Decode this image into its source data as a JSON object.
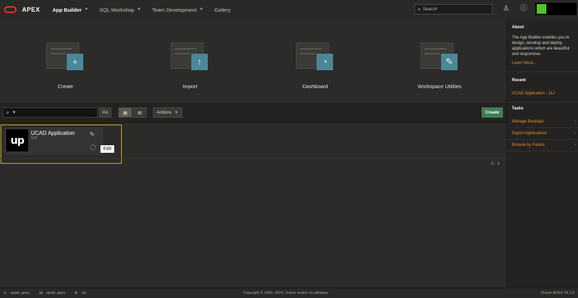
{
  "header": {
    "brand": "APEX",
    "nav": [
      {
        "label": "App Builder"
      },
      {
        "label": "SQL Workshop"
      },
      {
        "label": "Team Development"
      },
      {
        "label": "Gallery"
      }
    ],
    "search_placeholder": "Search",
    "icons": [
      "oracle-logo",
      "developer-icon",
      "help-icon",
      "user-avatar"
    ]
  },
  "tiles": [
    {
      "label": "Create",
      "icon": "plus-icon",
      "glyph": "+"
    },
    {
      "label": "Import",
      "icon": "upload-arrow-icon",
      "glyph": "↑"
    },
    {
      "label": "Dashboard",
      "icon": "gauge-icon",
      "glyph": "◔"
    },
    {
      "label": "Workspace Utilities",
      "icon": "wrench-icon",
      "glyph": "✎"
    }
  ],
  "toolbar": {
    "go_label": "Go",
    "actions_label": "Actions",
    "create_label": "Create"
  },
  "apps": [
    {
      "name": "UCAD Application",
      "id": "112",
      "logo_text": "up"
    }
  ],
  "tooltip": "Edit",
  "pagination": "1 - 1",
  "sidebar": {
    "about": {
      "heading": "About",
      "text": "The App Builder enables you to design, develop and deploy applications which are beautiful and responsive.",
      "link": "Learn More..."
    },
    "recent": {
      "heading": "Recent",
      "items": [
        {
          "label": "UCAD Application - 112"
        }
      ]
    },
    "tasks": {
      "heading": "Tasks",
      "items": [
        {
          "label": "Manage Backups"
        },
        {
          "label": "Export Applications"
        },
        {
          "label": "Browse by Facets"
        }
      ]
    }
  },
  "footer": {
    "user": "upwb_apex",
    "workspace": "upwb_apex",
    "language": "en",
    "copyright": "Copyright © 1999, 2024, Oracle and/or its affiliates.",
    "version": "Oracle APEX 24.2.0"
  },
  "colors": {
    "accent_green": "#3f7f54",
    "tile_badge": "#4a8798",
    "link_orange": "#e0902f",
    "selection_border": "#c9b22b"
  }
}
